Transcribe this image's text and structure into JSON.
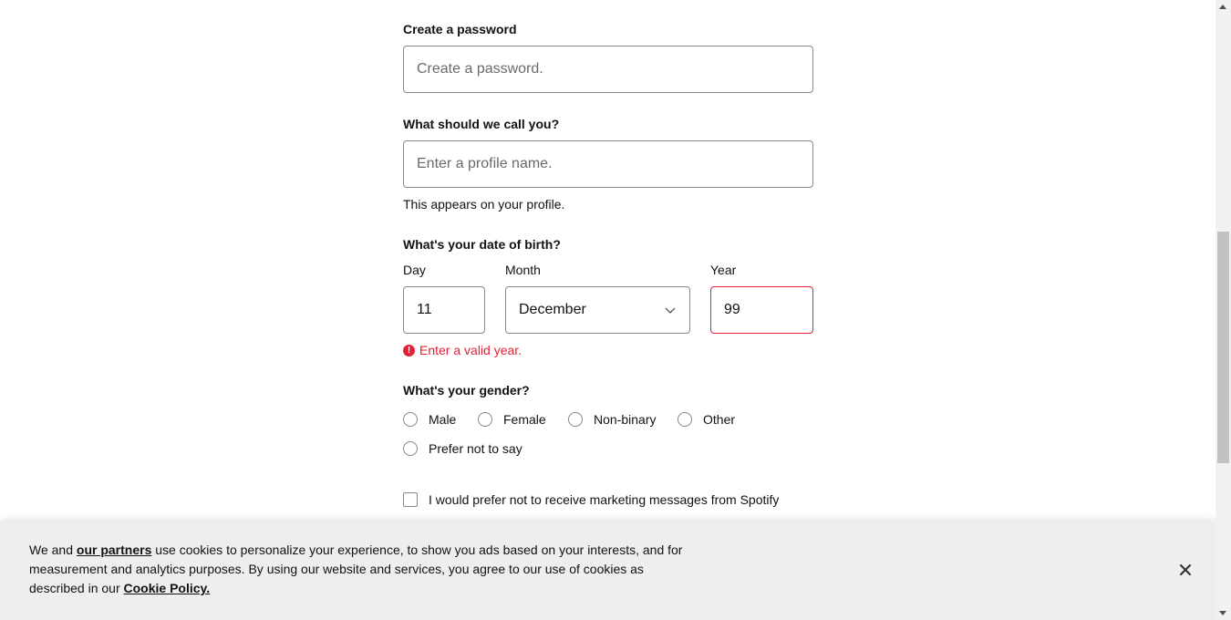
{
  "form": {
    "password": {
      "label": "Create a password",
      "placeholder": "Create a password."
    },
    "profile": {
      "label": "What should we call you?",
      "placeholder": "Enter a profile name.",
      "helper": "This appears on your profile."
    },
    "dob": {
      "label": "What's your date of birth?",
      "day": {
        "label": "Day",
        "value": "11"
      },
      "month": {
        "label": "Month",
        "value": "December"
      },
      "year": {
        "label": "Year",
        "value": "99"
      },
      "error": "Enter a valid year.",
      "error_icon": "!"
    },
    "gender": {
      "label": "What's your gender?",
      "options": [
        "Male",
        "Female",
        "Non-binary",
        "Other",
        "Prefer not to say"
      ]
    },
    "marketing": {
      "label": "I would prefer not to receive marketing messages from Spotify"
    }
  },
  "cookie": {
    "prefix": "We and ",
    "partners_link": "our partners",
    "middle": " use cookies to personalize your experience, to show you ads based on your interests, and for measurement and analytics purposes. By using our website and services, you agree to our use of cookies as described in our ",
    "policy_link": "Cookie Policy.",
    "close_icon": "close-icon"
  },
  "colors": {
    "error": "#e22134",
    "border": "#878787"
  }
}
